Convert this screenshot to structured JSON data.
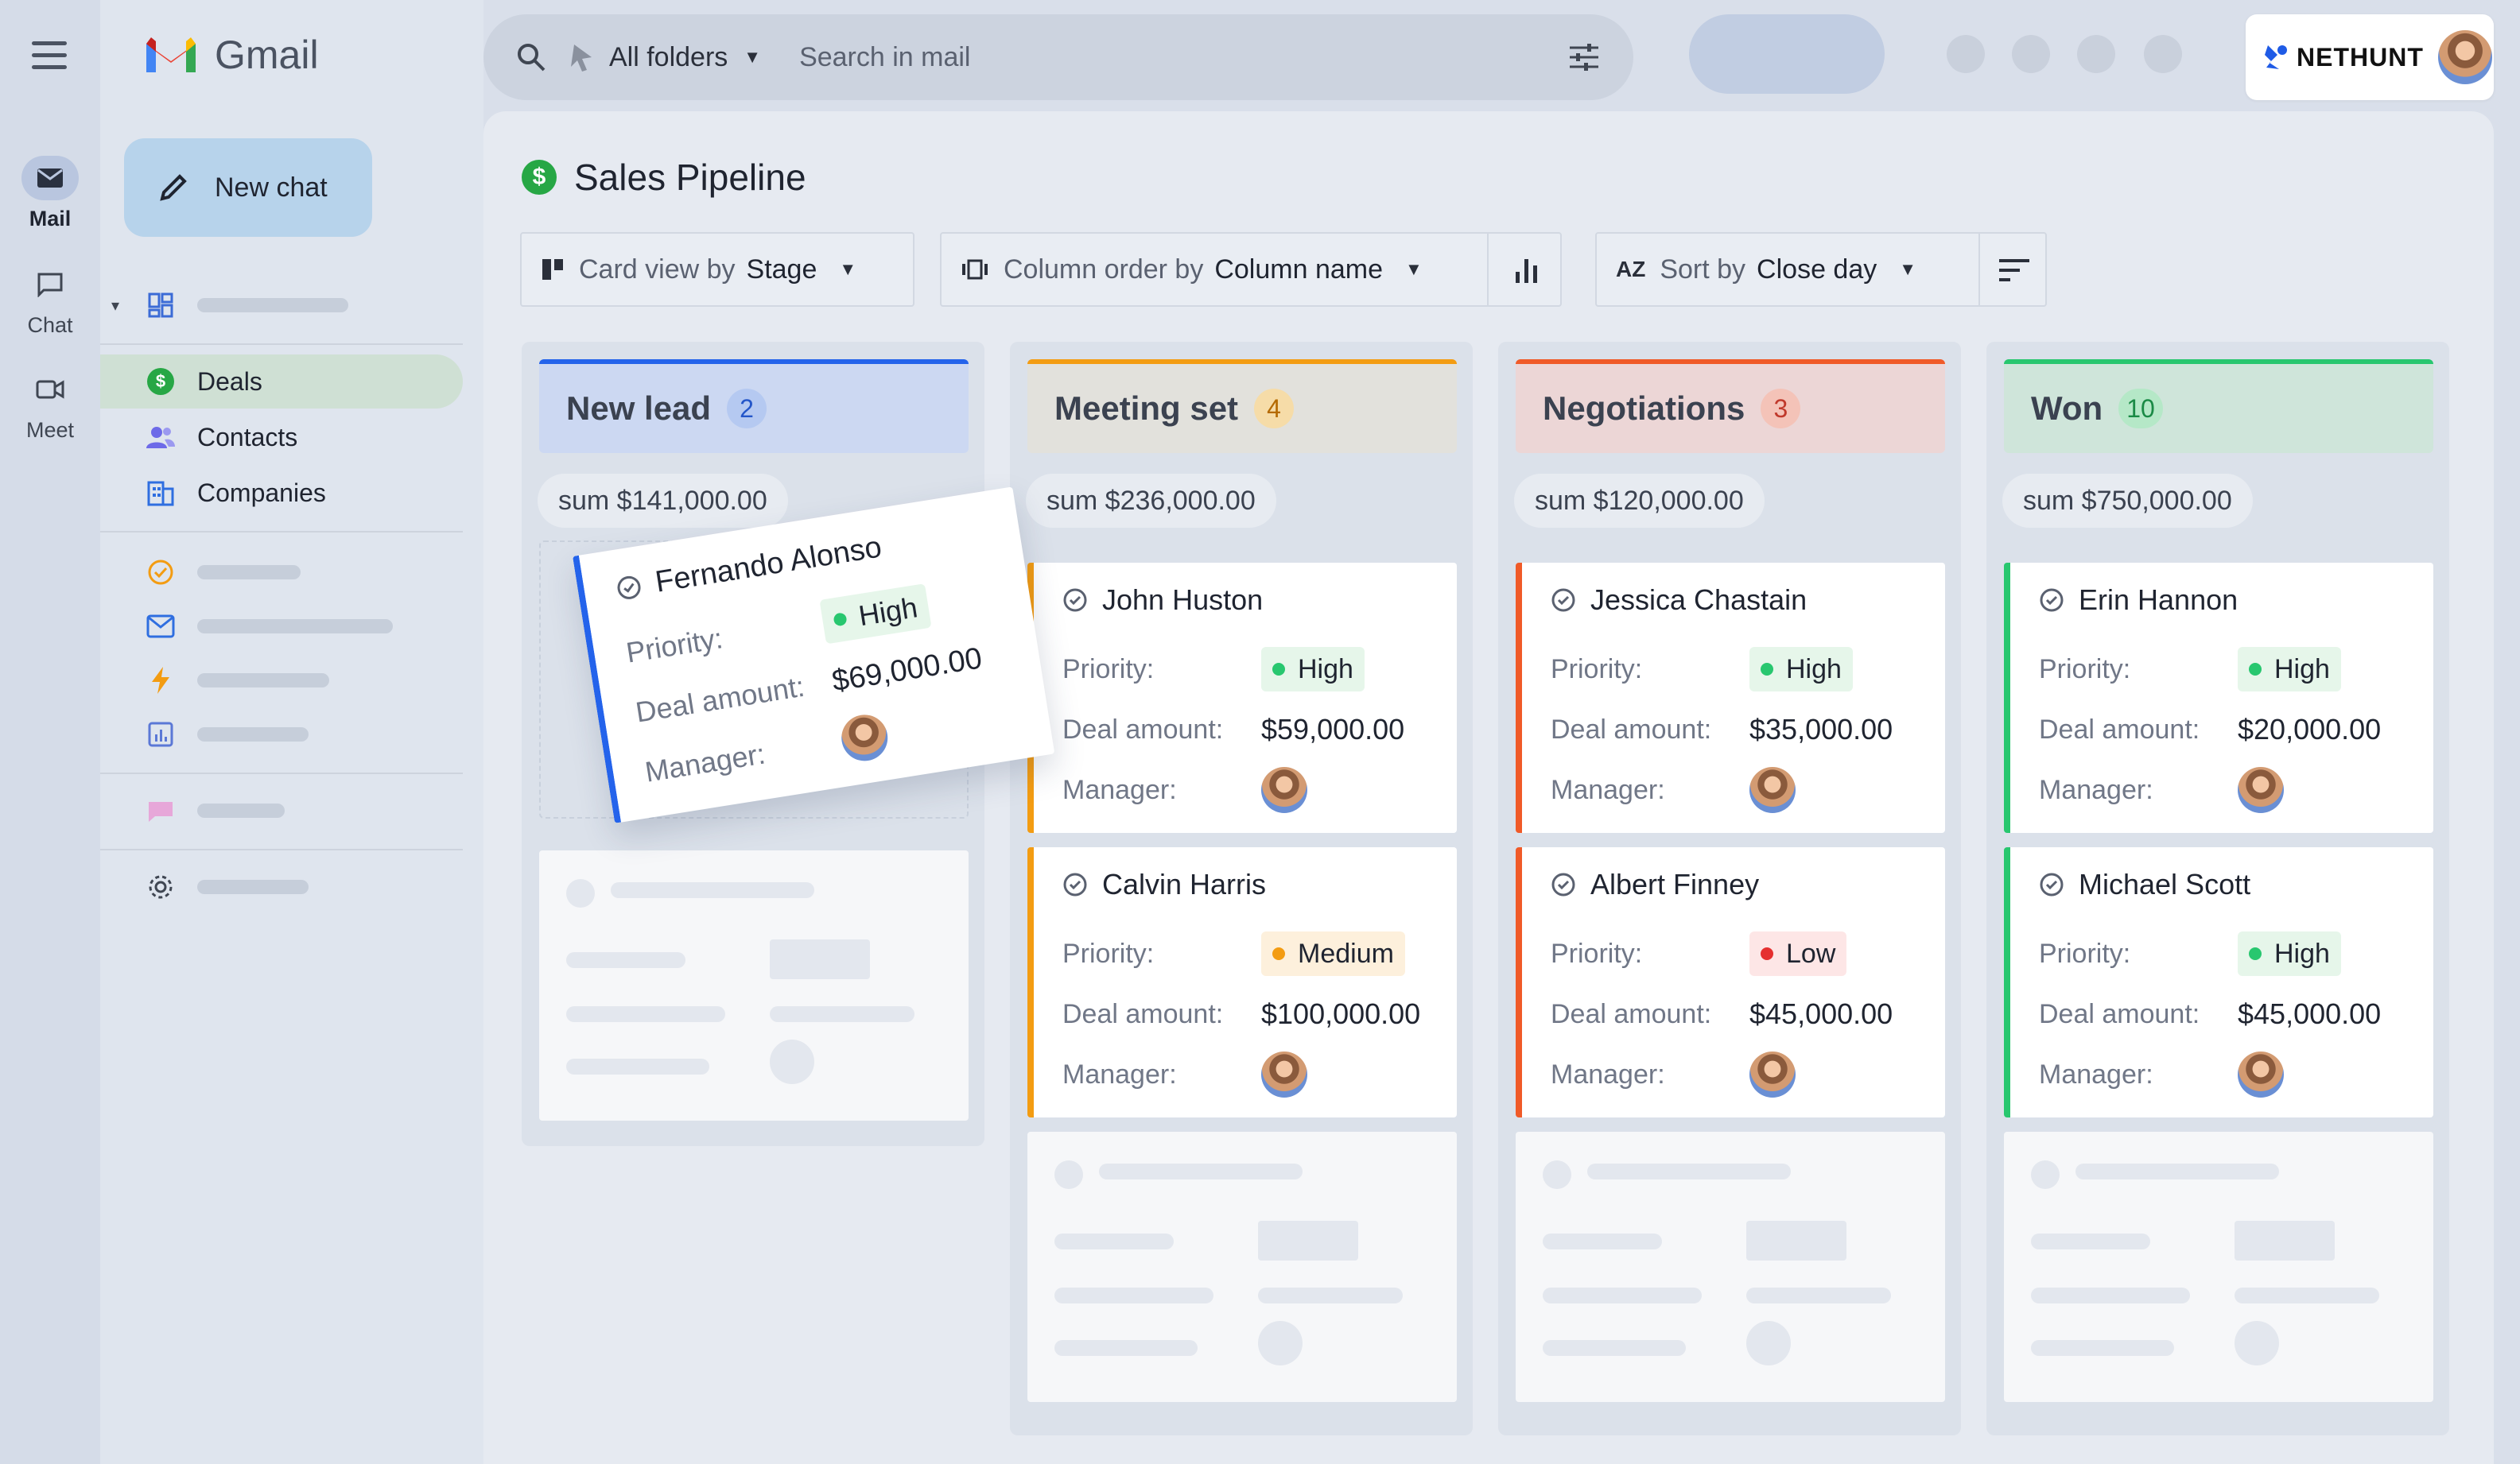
{
  "rail": {
    "items": [
      {
        "label": "Mail",
        "icon": "mail-icon"
      },
      {
        "label": "Chat",
        "icon": "chat-icon"
      },
      {
        "label": "Meet",
        "icon": "video-icon"
      }
    ]
  },
  "gmail": {
    "logo_text": "Gmail"
  },
  "sidebar": {
    "new_chat_label": "New chat",
    "items": [
      {
        "label": "Deals",
        "icon": "deals-icon"
      },
      {
        "label": "Contacts",
        "icon": "contacts-icon"
      },
      {
        "label": "Companies",
        "icon": "companies-icon"
      }
    ]
  },
  "search": {
    "folders_label": "All folders",
    "placeholder": "Search in mail"
  },
  "nethunt": {
    "brand": "NETHUNT"
  },
  "page": {
    "title": "Sales Pipeline"
  },
  "controls": {
    "card_view": {
      "label": "Card view by",
      "value": "Stage"
    },
    "column_order": {
      "label": "Column order by",
      "value": "Column name"
    },
    "sort": {
      "label": "Sort by",
      "value": "Close day"
    }
  },
  "labels": {
    "priority": "Priority:",
    "deal_amount": "Deal amount:",
    "manager": "Manager:"
  },
  "columns": [
    {
      "title": "New lead",
      "count": "2",
      "sum": "sum $141,000.00",
      "accent": "#2463eb",
      "head_bg": "#ccd8f2",
      "count_bg": "#b5c9f1",
      "count_color": "#2456c9"
    },
    {
      "title": "Meeting set",
      "count": "4",
      "sum": "sum $236,000.00",
      "accent": "#f39c12",
      "head_bg": "#e2e1dc",
      "count_bg": "#f6dca8",
      "count_color": "#b56a00"
    },
    {
      "title": "Negotiations",
      "count": "3",
      "sum": "sum $120,000.00",
      "accent": "#f05a28",
      "head_bg": "#ecd6d6",
      "count_bg": "#f4c3b8",
      "count_color": "#c0392b"
    },
    {
      "title": "Won",
      "count": "10",
      "sum": "sum $750,000.00",
      "accent": "#28c76f",
      "head_bg": "#cfe5da",
      "count_bg": "#b5e8c7",
      "count_color": "#1a8a45"
    }
  ],
  "dragging_card": {
    "name": "Fernando Alonso",
    "priority": "High",
    "amount": "$69,000.00"
  },
  "cards": [
    {
      "col": 1,
      "name": "John Huston",
      "priority": "High",
      "pri_color": "#28c76f",
      "pri_bg": "#e6f6ea",
      "amount": "$59,000.00"
    },
    {
      "col": 1,
      "name": "Calvin Harris",
      "priority": "Medium",
      "pri_color": "#f39c12",
      "pri_bg": "#fdf0dc",
      "amount": "$100,000.00"
    },
    {
      "col": 2,
      "name": "Jessica Chastain",
      "priority": "High",
      "pri_color": "#28c76f",
      "pri_bg": "#e6f6ea",
      "amount": "$35,000.00"
    },
    {
      "col": 2,
      "name": "Albert Finney",
      "priority": "Low",
      "pri_color": "#e52f2f",
      "pri_bg": "#fde6e6",
      "amount": "$45,000.00"
    },
    {
      "col": 3,
      "name": "Erin Hannon",
      "priority": "High",
      "pri_color": "#28c76f",
      "pri_bg": "#e6f6ea",
      "amount": "$20,000.00"
    },
    {
      "col": 3,
      "name": "Michael Scott",
      "priority": "High",
      "pri_color": "#28c76f",
      "pri_bg": "#e6f6ea",
      "amount": "$45,000.00"
    }
  ]
}
